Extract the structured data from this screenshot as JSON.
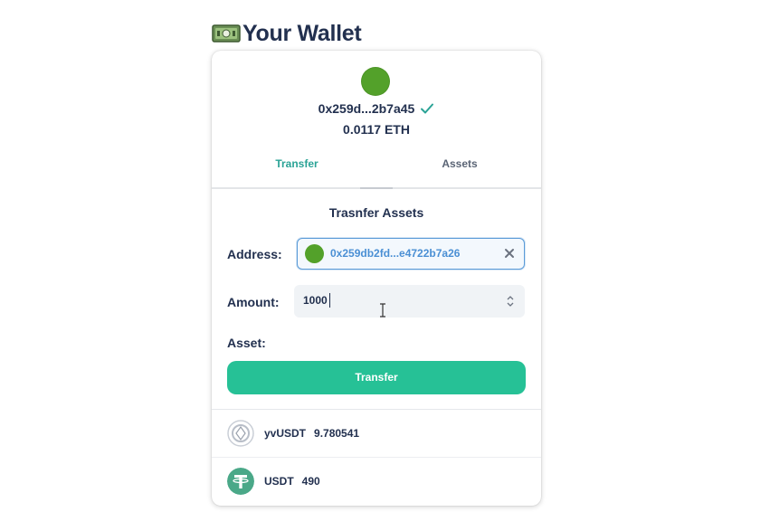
{
  "header": {
    "title": "Your Wallet",
    "icon": "money-bill-icon"
  },
  "wallet": {
    "address": "0x259d...2b7a45",
    "balance": "0.0117 ETH",
    "avatar_color": "#53a12a",
    "verified_color": "#2aa396"
  },
  "tabs": [
    {
      "label": "Transfer",
      "active": true
    },
    {
      "label": "Assets",
      "active": false
    }
  ],
  "transfer": {
    "section_title": "Trasnfer Assets",
    "address_label": "Address:",
    "address_value": "0x259db2fd...e4722b7a26",
    "amount_label": "Amount:",
    "amount_value": "1000",
    "asset_label": "Asset:",
    "button_label": "Transfer",
    "button_color": "#26c196"
  },
  "assets": [
    {
      "name": "yvUSDT",
      "amount": "9.780541",
      "icon": "yearn-vault-icon"
    },
    {
      "name": "USDT",
      "amount": "490",
      "icon": "tether-icon",
      "icon_color": "#4aa888"
    }
  ]
}
